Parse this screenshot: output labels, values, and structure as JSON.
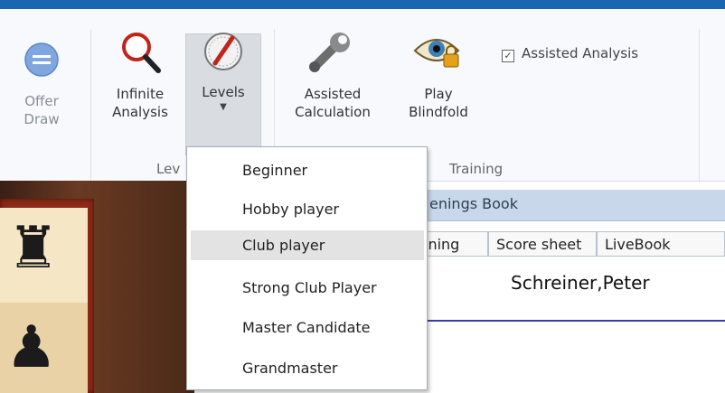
{
  "ribbon": {
    "offer_draw": {
      "label": "Offer\nDraw",
      "icon": "minus-circle-icon",
      "enabled": false
    },
    "infinite_analysis": {
      "label": "Infinite\nAnalysis",
      "icon": "magnifier-icon"
    },
    "levels": {
      "label": "Levels",
      "icon": "level-dial-icon"
    },
    "group_levels_label": "Lev",
    "assisted_calculation": {
      "label": "Assisted\nCalculation",
      "icon": "wrench-icon"
    },
    "play_blindfold": {
      "label": "Play\nBlindfold",
      "icon": "eye-lock-icon"
    },
    "assisted_analysis_checkbox": {
      "label": "Assisted Analysis",
      "checked": true
    },
    "group_training_label": "Training"
  },
  "levels_menu": {
    "items": [
      {
        "label": "Beginner",
        "selected": false
      },
      {
        "label": "Hobby player",
        "selected": false
      },
      {
        "label": "Club player",
        "selected": true
      },
      {
        "label": "Strong Club Player",
        "selected": false
      },
      {
        "label": "Master Candidate",
        "selected": false
      },
      {
        "label": "Grandmaster",
        "selected": false
      }
    ]
  },
  "panel": {
    "title": "enings Book",
    "tabs": [
      "ining",
      "Score sheet",
      "LiveBook"
    ],
    "player_name": "Schreiner,Peter"
  },
  "colors": {
    "accent": "#1a66b0",
    "menu_highlight": "#e3e3e3",
    "panel_header": "#c9d7ea"
  }
}
